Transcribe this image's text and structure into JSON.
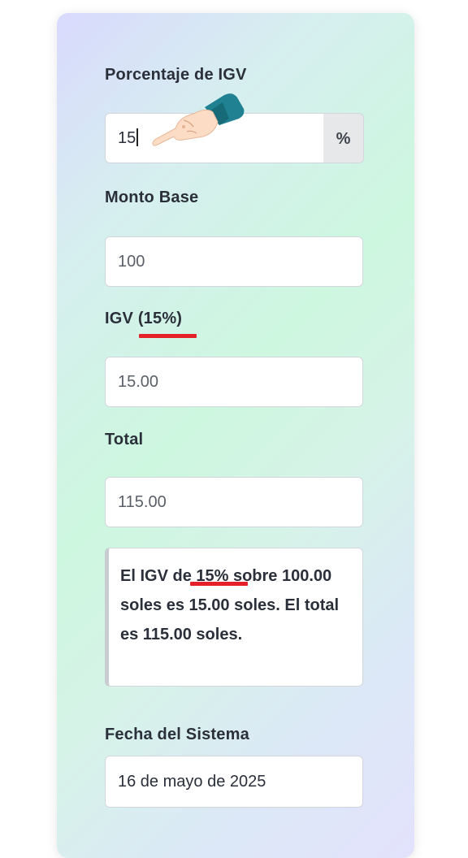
{
  "form": {
    "igv_percent_label": "Porcentaje de IGV",
    "igv_percent_value": "15",
    "percent_addon": "%",
    "base_label": "Monto Base",
    "base_value": "100",
    "igv_label_prefix": "IGV ",
    "igv_label_percent": "(15%)",
    "igv_value": "15.00",
    "total_label": "Total",
    "total_value": "115.00"
  },
  "summary": {
    "prefix": "El IGV d",
    "highlight": "e 15%",
    "suffix": " sobre 100.00 soles es 15.00 soles. El total es 115.00 soles."
  },
  "system_date": {
    "label": "Fecha del Sistema",
    "value": "16 de mayo de 2025"
  },
  "colors": {
    "annotation_underline": "#e42128",
    "pointer_sleeve": "#1f8191",
    "pointer_skin": "#fcdcc4"
  },
  "icons": {
    "pointer": "pointing-hand-icon"
  }
}
